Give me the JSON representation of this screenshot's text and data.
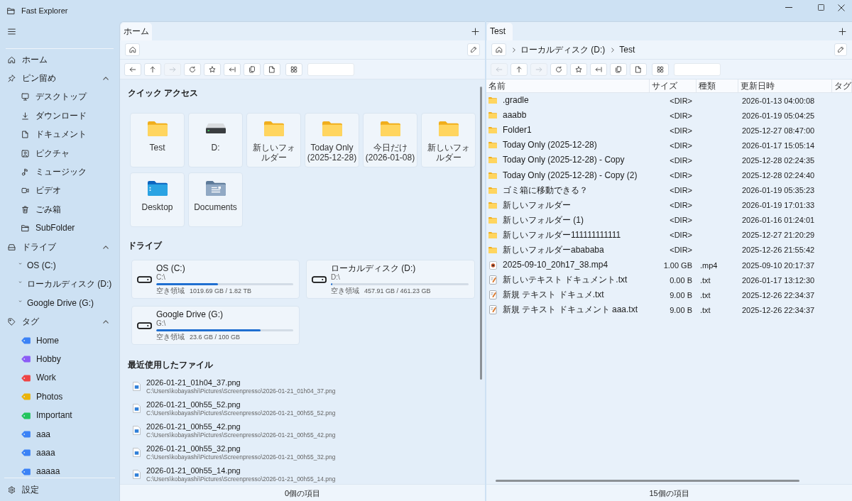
{
  "window": {
    "title": "Fast Explorer"
  },
  "sidebar": {
    "items": [
      {
        "kind": "home",
        "label": "ホーム"
      },
      {
        "kind": "pinned",
        "label": "ピン留め",
        "expanded": true,
        "children": [
          {
            "kind": "desktop",
            "label": "デスクトップ"
          },
          {
            "kind": "download",
            "label": "ダウンロード"
          },
          {
            "kind": "document",
            "label": "ドキュメント"
          },
          {
            "kind": "picture",
            "label": "ピクチャ"
          },
          {
            "kind": "music",
            "label": "ミュージック"
          },
          {
            "kind": "video",
            "label": "ビデオ"
          },
          {
            "kind": "trash",
            "label": "ごみ箱"
          },
          {
            "kind": "folder",
            "label": "SubFolder"
          }
        ]
      },
      {
        "kind": "drives",
        "label": "ドライブ",
        "expanded": true,
        "children": [
          {
            "kind": "drive",
            "label": "OS (C:)"
          },
          {
            "kind": "drive",
            "label": "ローカルディスク (D:)"
          },
          {
            "kind": "drive",
            "label": "Google Drive (G:)"
          }
        ]
      },
      {
        "kind": "tags",
        "label": "タグ",
        "expanded": true,
        "children": [
          {
            "kind": "tag",
            "label": "Home",
            "color": "#3b82f6"
          },
          {
            "kind": "tag",
            "label": "Hobby",
            "color": "#8b5cf6"
          },
          {
            "kind": "tag",
            "label": "Work",
            "color": "#ef4444"
          },
          {
            "kind": "tag",
            "label": "Photos",
            "color": "#eab308"
          },
          {
            "kind": "tag",
            "label": "Important",
            "color": "#22c55e"
          },
          {
            "kind": "tag",
            "label": "aaa",
            "color": "#3b82f6"
          },
          {
            "kind": "tag",
            "label": "aaaa",
            "color": "#3b82f6"
          },
          {
            "kind": "tag",
            "label": "aaaaa",
            "color": "#3b82f6"
          }
        ]
      }
    ],
    "settings": {
      "label": "設定"
    }
  },
  "panes": [
    {
      "tabs": [
        {
          "label": "ホーム",
          "selected": true
        }
      ],
      "toolbar": [
        {
          "kind": "back",
          "disabled": false
        },
        {
          "kind": "up",
          "disabled": false
        },
        {
          "kind": "forward",
          "disabled": true
        },
        {
          "kind": "refresh",
          "disabled": false
        },
        {
          "kind": "favorite",
          "disabled": false
        },
        {
          "kind": "collapse",
          "disabled": false
        },
        {
          "kind": "copy",
          "disabled": false
        },
        {
          "kind": "new_file",
          "disabled": false
        },
        {
          "kind": "view",
          "disabled": false
        }
      ],
      "quick_access": {
        "title": "クイック アクセス",
        "items": [
          {
            "kind": "folder",
            "label": "Test"
          },
          {
            "kind": "drive",
            "label": "D:"
          },
          {
            "kind": "folder",
            "label": "新しいフォルダー"
          },
          {
            "kind": "folder",
            "label": "Today Only (2025-12-28)"
          },
          {
            "kind": "folder",
            "label": "今日だけ (2026-01-08)"
          },
          {
            "kind": "folder",
            "label": "新しいフォルダー"
          },
          {
            "kind": "desktop",
            "label": "Desktop"
          },
          {
            "kind": "documents",
            "label": "Documents"
          }
        ]
      },
      "drives": {
        "title": "ドライブ",
        "items": [
          {
            "name": "OS (C:)",
            "path": "C:\\",
            "free_label": "空き領域",
            "free": "1019.69 GB / 1.82 TB",
            "level": 0.45
          },
          {
            "name": "ローカルディスク (D:)",
            "path": "D:\\",
            "free_label": "空き領域",
            "free": "457.91 GB / 461.23 GB",
            "level": 0.01
          },
          {
            "name": "Google Drive (G:)",
            "path": "G:\\",
            "free_label": "空き領域",
            "free": "23.6 GB / 100 GB",
            "level": 0.76
          }
        ]
      },
      "recent_files": {
        "title": "最近使用したファイル",
        "items": [
          {
            "name": "2026-01-21_01h04_37.png",
            "path": "C:\\Users\\kobayashi\\Pictures\\Screenpresso\\2026-01-21_01h04_37.png"
          },
          {
            "name": "2026-01-21_00h55_52.png",
            "path": "C:\\Users\\kobayashi\\Pictures\\Screenpresso\\2026-01-21_00h55_52.png"
          },
          {
            "name": "2026-01-21_00h55_42.png",
            "path": "C:\\Users\\kobayashi\\Pictures\\Screenpresso\\2026-01-21_00h55_42.png"
          },
          {
            "name": "2026-01-21_00h55_32.png",
            "path": "C:\\Users\\kobayashi\\Pictures\\Screenpresso\\2026-01-21_00h55_32.png"
          },
          {
            "name": "2026-01-21_00h55_14.png",
            "path": "C:\\Users\\kobayashi\\Pictures\\Screenpresso\\2026-01-21_00h55_14.png"
          }
        ]
      },
      "status_bar": "0個の項目"
    },
    {
      "tabs": [
        {
          "label": "Test",
          "selected": true
        }
      ],
      "breadcrumb": [
        "ローカルディスク (D:)",
        "Test"
      ],
      "toolbar": [
        {
          "kind": "back",
          "disabled": true
        },
        {
          "kind": "up",
          "disabled": false
        },
        {
          "kind": "forward",
          "disabled": true
        },
        {
          "kind": "refresh",
          "disabled": false
        },
        {
          "kind": "favorite",
          "disabled": false
        },
        {
          "kind": "collapse",
          "disabled": false
        },
        {
          "kind": "copy",
          "disabled": false
        },
        {
          "kind": "new_file",
          "disabled": false
        },
        {
          "kind": "view",
          "disabled": false
        }
      ],
      "table": {
        "columns": [
          "名前",
          "サイズ",
          "種類",
          "更新日時",
          "タグ"
        ],
        "rows": [
          {
            "kind": "folder",
            "name": ".gradle",
            "size": "<DIR>",
            "modified": "2026-01-13 04:00:08"
          },
          {
            "kind": "folder",
            "name": "aaabb",
            "size": "<DIR>",
            "modified": "2026-01-19 05:04:25"
          },
          {
            "kind": "folder",
            "name": "Folder1",
            "size": "<DIR>",
            "modified": "2025-12-27 08:47:00"
          },
          {
            "kind": "folder",
            "name": "Today Only (2025-12-28)",
            "size": "<DIR>",
            "modified": "2026-01-17 15:05:14"
          },
          {
            "kind": "folder",
            "name": "Today Only (2025-12-28) - Copy",
            "size": "<DIR>",
            "modified": "2025-12-28 02:24:35"
          },
          {
            "kind": "folder",
            "name": "Today Only (2025-12-28) - Copy (2)",
            "size": "<DIR>",
            "modified": "2025-12-28 02:24:40"
          },
          {
            "kind": "folder",
            "name": "ゴミ箱に移動できる？",
            "size": "<DIR>",
            "modified": "2026-01-19 05:35:23"
          },
          {
            "kind": "folder",
            "name": "新しいフォルダー",
            "size": "<DIR>",
            "modified": "2026-01-19 17:01:33"
          },
          {
            "kind": "folder",
            "name": "新しいフォルダー (1)",
            "size": "<DIR>",
            "modified": "2026-01-16 01:24:01"
          },
          {
            "kind": "folder",
            "name": "新しいフォルダー111111111111",
            "size": "<DIR>",
            "modified": "2025-12-27 21:20:29"
          },
          {
            "kind": "folder",
            "name": "新しいフォルダーabababa",
            "size": "<DIR>",
            "modified": "2025-12-26 21:55:42"
          },
          {
            "kind": "video",
            "name": "2025-09-10_20h17_38.mp4",
            "size": "1.00 GB",
            "type": ".mp4",
            "modified": "2025-09-10 20:17:37"
          },
          {
            "kind": "text",
            "name": "新しいテキスト ドキュメント.txt",
            "size": "0.00 B",
            "type": ".txt",
            "modified": "2026-01-17 13:12:30"
          },
          {
            "kind": "text",
            "name": "新規 テキスト ドキュメ.txt",
            "size": "9.00 B",
            "type": ".txt",
            "modified": "2025-12-26 22:34:37"
          },
          {
            "kind": "text",
            "name": "新規 テキスト ドキュメント aaa.txt",
            "size": "9.00 B",
            "type": ".txt",
            "modified": "2025-12-26 22:34:37"
          }
        ]
      },
      "status_bar": "15個の項目"
    }
  ]
}
